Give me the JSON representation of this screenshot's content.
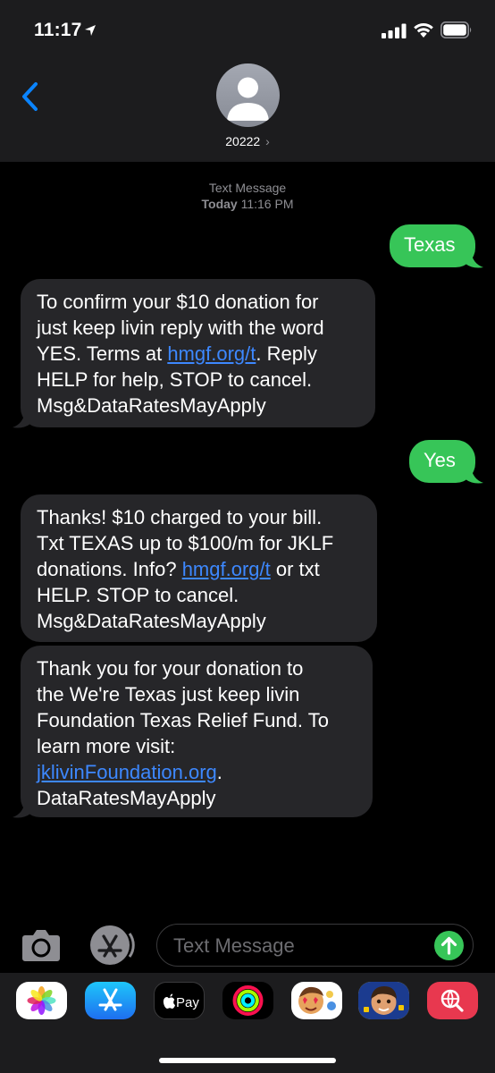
{
  "status_bar": {
    "time": "11:17"
  },
  "header": {
    "contact": "20222",
    "chevron": "›"
  },
  "thread": {
    "meta_line1": "Text Message",
    "meta_day": "Today",
    "meta_time": "11:16 PM"
  },
  "messages": {
    "m1": {
      "text": "Texas"
    },
    "m2": {
      "l1": "To confirm your $10 donation for",
      "l2": "just keep livin reply with the word",
      "l3a": "YES. Terms at ",
      "l3link": "hmgf.org/t",
      "l3b": ". Reply",
      "l4": "HELP for help, STOP to cancel.",
      "l5": "Msg&DataRatesMayApply"
    },
    "m3": {
      "text": "Yes"
    },
    "m4": {
      "l1": "Thanks! $10 charged to your bill.",
      "l2": "Txt TEXAS up to $100/m for JKLF",
      "l3a": "donations. Info? ",
      "l3link": "hmgf.org/t",
      "l3b": " or txt",
      "l4": "HELP. STOP to cancel.",
      "l5": "Msg&DataRatesMayApply"
    },
    "m5": {
      "l1": "Thank you for your donation to",
      "l2": "the We're Texas just keep livin",
      "l3": "Foundation Texas Relief Fund. To",
      "l4": "learn more visit:",
      "l5link": "jklivinFoundation.org",
      "l5b": ".",
      "l6": "DataRatesMayApply"
    }
  },
  "composer": {
    "placeholder": "Text Message"
  },
  "drawer": {
    "apple_pay_label": "Pay",
    "apps": [
      "photos-app",
      "app-store-app",
      "apple-pay-app",
      "activity-app",
      "memoji-stickers-app",
      "memoji-app",
      "search-images-app"
    ]
  },
  "colors": {
    "outgoing_bubble": "#37c558",
    "incoming_bubble": "#262629",
    "link": "#3d88ff",
    "header_bg": "#1c1c1e",
    "back_chevron": "#0a84ff"
  }
}
